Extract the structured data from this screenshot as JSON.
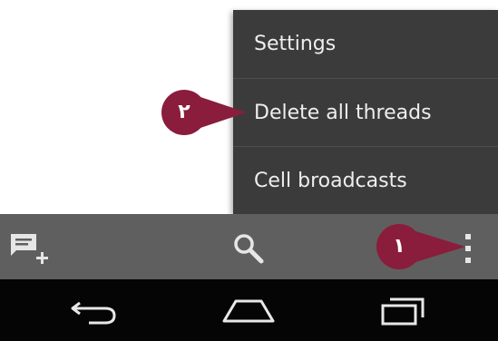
{
  "overflow_menu": {
    "items": [
      {
        "label": "Settings"
      },
      {
        "label": "Delete all threads"
      },
      {
        "label": "Cell broadcasts"
      }
    ]
  },
  "callouts": [
    {
      "number": "٢",
      "target": "Delete all threads"
    },
    {
      "number": "١",
      "target": "overflow menu button"
    }
  ],
  "action_bar": {
    "icons": [
      "new-message-icon",
      "search-icon",
      "overflow-menu-icon"
    ]
  },
  "nav_bar": {
    "icons": [
      "back-icon",
      "home-icon",
      "recent-apps-icon"
    ]
  },
  "colors": {
    "menu_bg": "#3b3b3b",
    "action_bar_bg": "#5f5f5f",
    "nav_bar_bg": "#050505",
    "callout": "#8a1c3c"
  }
}
